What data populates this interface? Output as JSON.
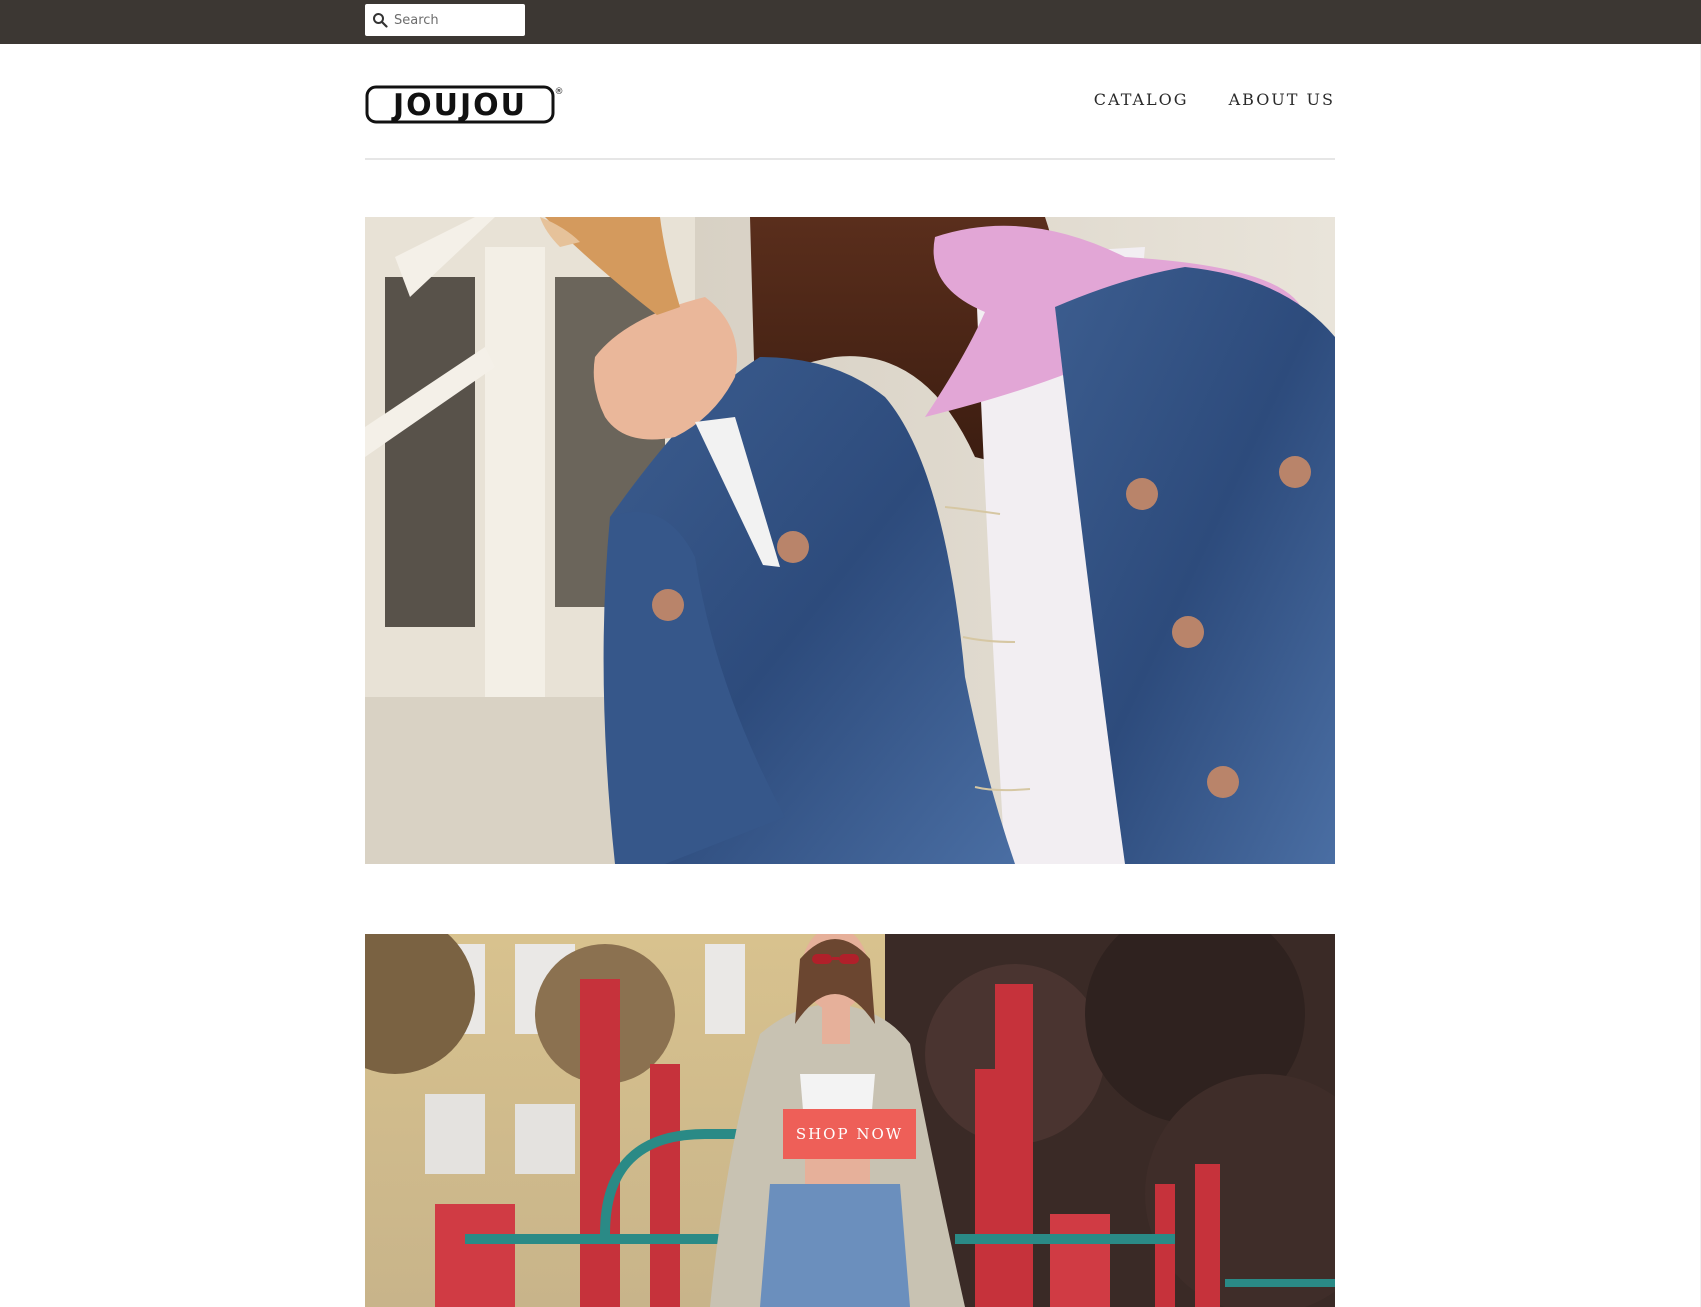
{
  "topbar": {
    "search_placeholder": "Search",
    "background": "#3c3733"
  },
  "header": {
    "logo_text": "JOUJOU",
    "logo_mark": "®",
    "nav": [
      {
        "label": "CATALOG"
      },
      {
        "label": "ABOUT US"
      }
    ]
  },
  "hero_banner": {
    "image_subject": "denim-jacket-ice-cream-photo"
  },
  "promo_banner": {
    "image_subject": "playground-fashion-photo",
    "cta_label": "SHOP NOW",
    "cta_color": "#ee5f58"
  },
  "icons": {
    "search": "search-icon"
  }
}
